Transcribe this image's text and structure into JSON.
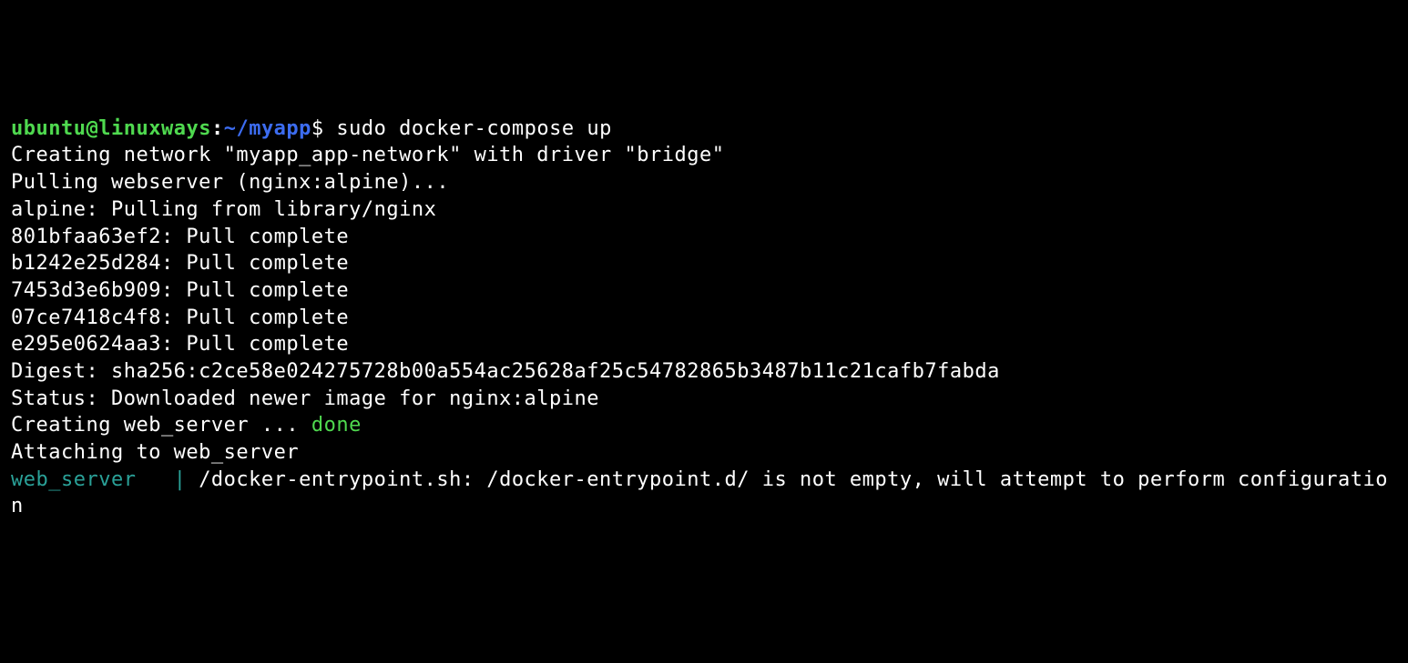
{
  "prompt": {
    "user": "ubuntu",
    "at": "@",
    "host": "linuxways",
    "colon": ":",
    "path": "~/myapp",
    "dollar": "$ ",
    "command": "sudo docker-compose up"
  },
  "lines": {
    "l1": "Creating network \"myapp_app-network\" with driver \"bridge\"",
    "l2": "Pulling webserver (nginx:alpine)...",
    "l3": "alpine: Pulling from library/nginx",
    "l4": "801bfaa63ef2: Pull complete",
    "l5": "b1242e25d284: Pull complete",
    "l6": "7453d3e6b909: Pull complete",
    "l7": "07ce7418c4f8: Pull complete",
    "l8": "e295e0624aa3: Pull complete",
    "l9": "Digest: sha256:c2ce58e024275728b00a554ac25628af25c54782865b3487b11c21cafb7fabda",
    "l10": "Status: Downloaded newer image for nginx:alpine",
    "l11_prefix": "Creating web_server ... ",
    "l11_done": "done",
    "l12": "Attaching to web_server",
    "l13_service": "web_server   ",
    "l13_pipe": "| ",
    "l13_msg": "/docker-entrypoint.sh: /docker-entrypoint.d/ is not empty, will attempt to perform configuration"
  }
}
